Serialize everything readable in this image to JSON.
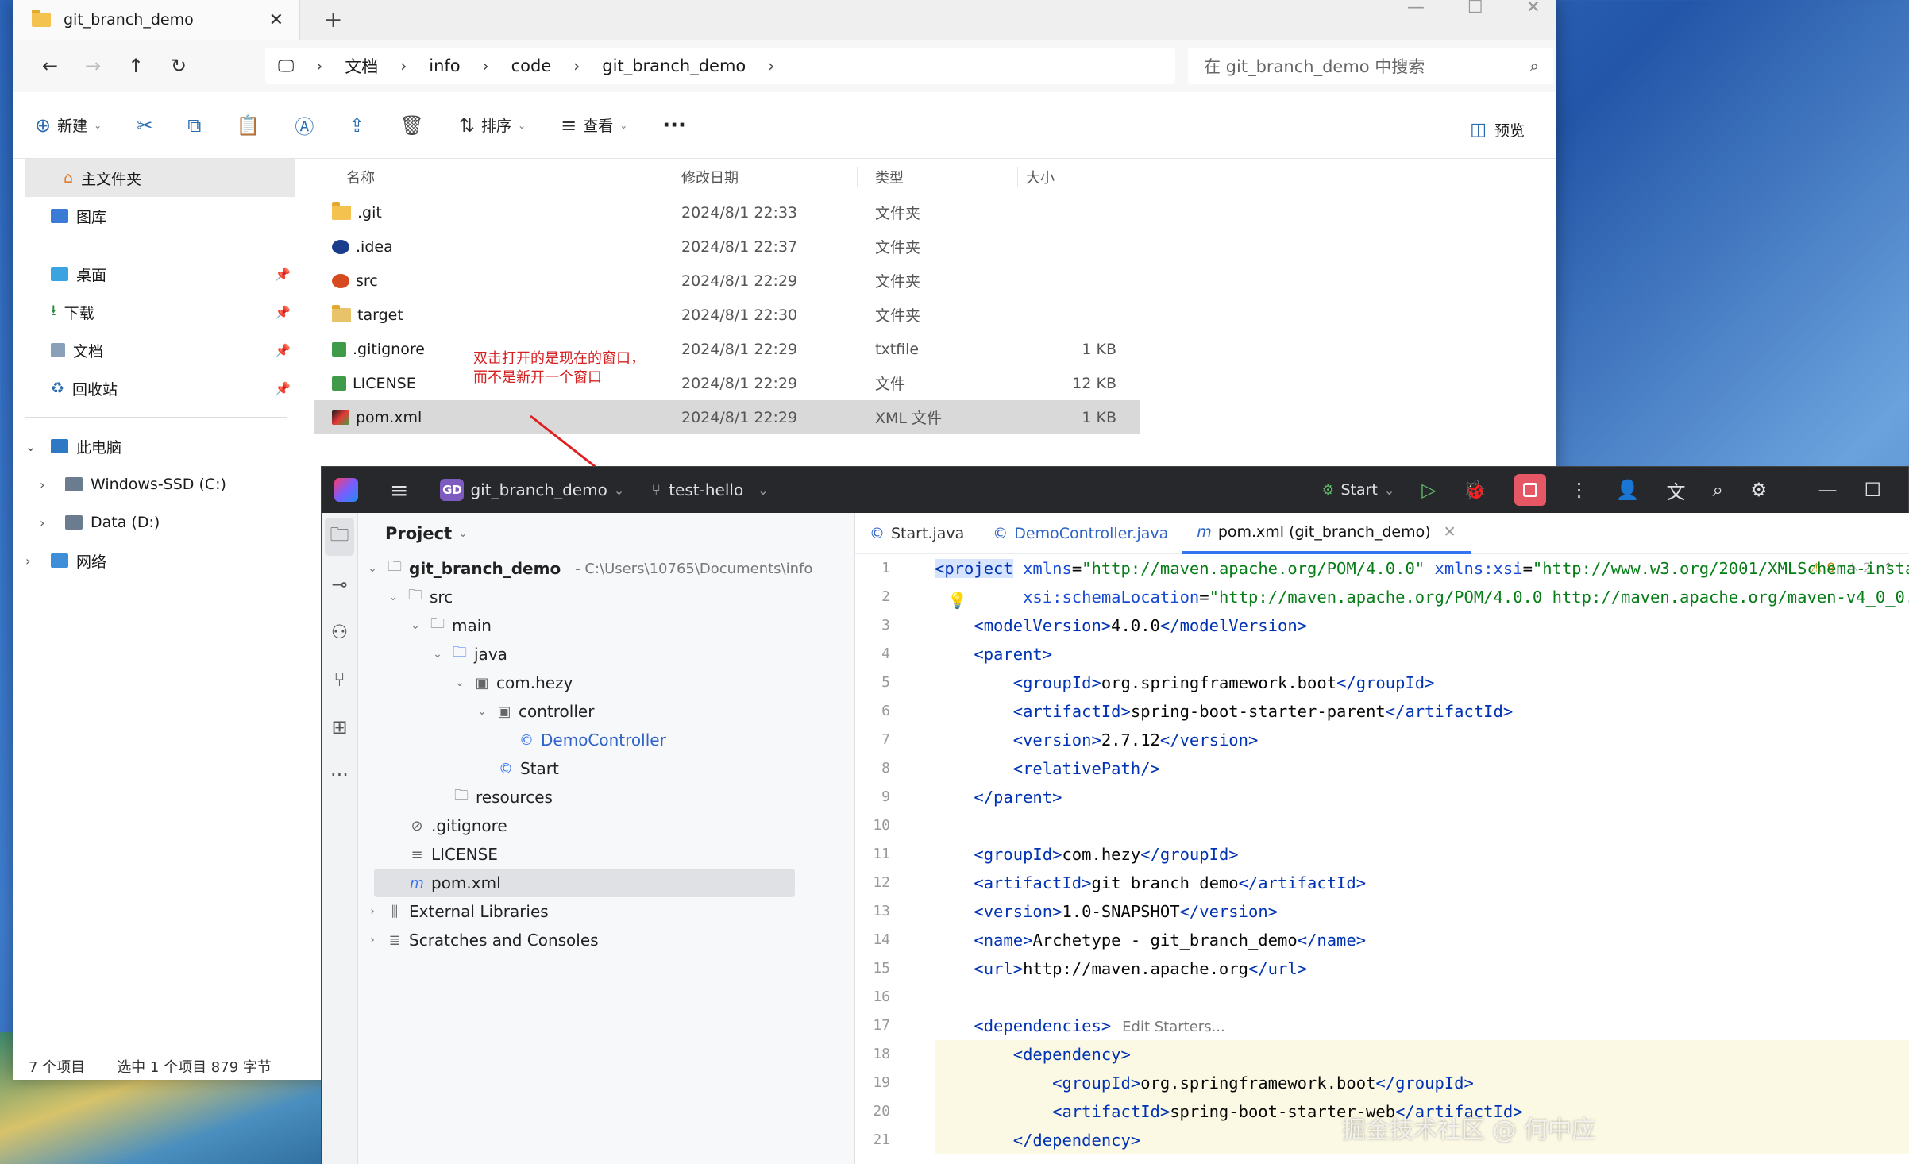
{
  "explorer": {
    "tab_title": "git_branch_demo",
    "breadcrumb": [
      "文档",
      "info",
      "code",
      "git_branch_demo"
    ],
    "search_placeholder": "在 git_branch_demo 中搜索",
    "toolbar": {
      "new": "新建",
      "sort": "排序",
      "view": "查看",
      "preview": "预览"
    },
    "sidebar": {
      "home": "主文件夹",
      "gallery": "图库",
      "desktop": "桌面",
      "downloads": "下载",
      "documents": "文档",
      "recycle": "回收站",
      "this_pc": "此电脑",
      "drive_c": "Windows-SSD (C:)",
      "drive_d": "Data (D:)",
      "network": "网络"
    },
    "columns": {
      "name": "名称",
      "date": "修改日期",
      "type": "类型",
      "size": "大小"
    },
    "files": [
      {
        "name": ".git",
        "date": "2024/8/1 22:33",
        "type": "文件夹",
        "size": ""
      },
      {
        "name": ".idea",
        "date": "2024/8/1 22:37",
        "type": "文件夹",
        "size": ""
      },
      {
        "name": "src",
        "date": "2024/8/1 22:29",
        "type": "文件夹",
        "size": ""
      },
      {
        "name": "target",
        "date": "2024/8/1 22:30",
        "type": "文件夹",
        "size": ""
      },
      {
        "name": ".gitignore",
        "date": "2024/8/1 22:29",
        "type": "txtfile",
        "size": "1 KB"
      },
      {
        "name": "LICENSE",
        "date": "2024/8/1 22:29",
        "type": "文件",
        "size": "12 KB"
      },
      {
        "name": "pom.xml",
        "date": "2024/8/1 22:29",
        "type": "XML 文件",
        "size": "1 KB"
      }
    ],
    "annotation_line1": "双击打开的是现在的窗口，",
    "annotation_line2": "而不是新开一个窗口",
    "status_count": "7 个项目",
    "status_selected": "选中 1 个项目  879 字节"
  },
  "ide": {
    "badge": "GD",
    "project_name": "git_branch_demo",
    "branch": "test-hello",
    "run_config": "Start",
    "project_panel_title": "Project",
    "tree": [
      {
        "label": "git_branch_demo",
        "path": "- C:\\Users\\10765\\Documents\\info"
      },
      {
        "label": "src"
      },
      {
        "label": "main"
      },
      {
        "label": "java"
      },
      {
        "label": "com.hezy"
      },
      {
        "label": "controller"
      },
      {
        "label": "DemoController"
      },
      {
        "label": "Start"
      },
      {
        "label": "resources"
      },
      {
        "label": ".gitignore"
      },
      {
        "label": "LICENSE"
      },
      {
        "label": "pom.xml"
      },
      {
        "label": "External Libraries"
      },
      {
        "label": "Scratches and Consoles"
      }
    ],
    "tabs": [
      "Start.java",
      "DemoController.java",
      "pom.xml (git_branch_demo)"
    ],
    "warnings": {
      "w1": "9",
      "w2": "2"
    },
    "edit_starters": "Edit Starters...",
    "line_numbers": [
      "1",
      "2",
      "3",
      "4",
      "5",
      "6",
      "7",
      "8",
      "9",
      "10",
      "11",
      "12",
      "13",
      "14",
      "15",
      "16",
      "17",
      "18",
      "19",
      "20",
      "21"
    ]
  },
  "watermark": "掘金技术社区 @ 何中应"
}
